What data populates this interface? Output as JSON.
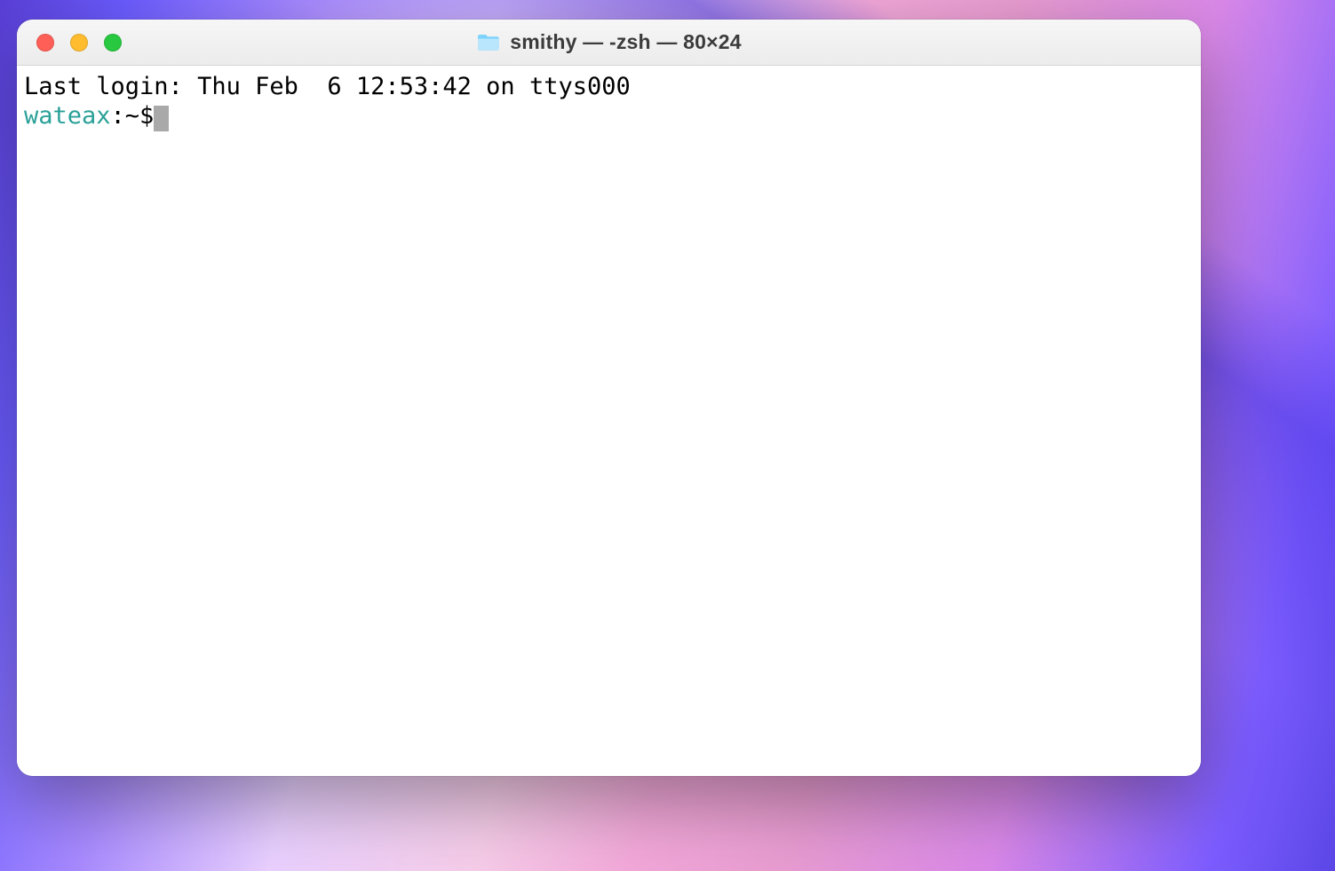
{
  "window": {
    "title": "smithy — -zsh — 80×24",
    "folder_icon_name": "folder-icon"
  },
  "traffic_lights": {
    "close": "close",
    "minimize": "minimize",
    "zoom": "zoom"
  },
  "terminal": {
    "last_login_line": "Last login: Thu Feb  6 12:53:42 on ttys000",
    "prompt_user": "wateax",
    "prompt_tail": ":~$"
  },
  "colors": {
    "prompt_user": "#2aa198",
    "cursor": "#a9a9a9",
    "titlebar_text": "#3b3b3b"
  }
}
